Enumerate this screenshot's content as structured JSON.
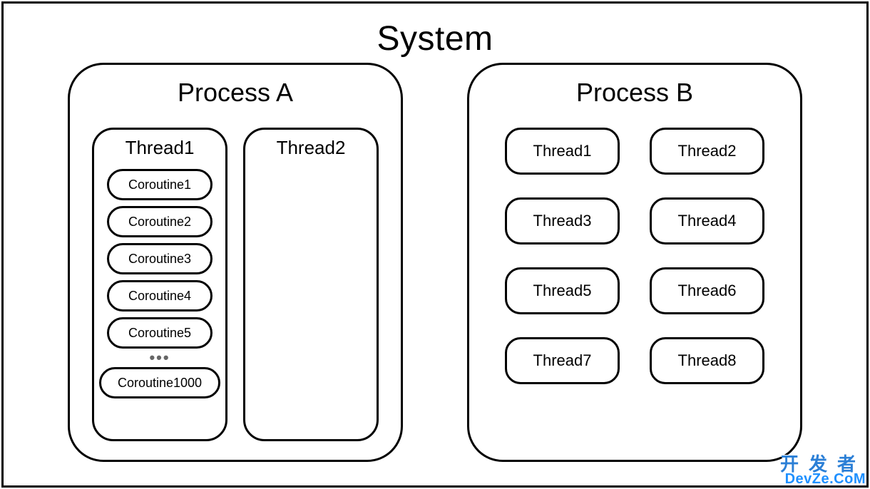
{
  "system": {
    "title": "System"
  },
  "processA": {
    "title": "Process A",
    "thread1": {
      "title": "Thread1",
      "coroutines": [
        "Coroutine1",
        "Coroutine2",
        "Coroutine3",
        "Coroutine4",
        "Coroutine5"
      ],
      "ellipsis": "•••",
      "last": "Coroutine1000"
    },
    "thread2": {
      "title": "Thread2"
    }
  },
  "processB": {
    "title": "Process B",
    "threads": [
      "Thread1",
      "Thread2",
      "Thread3",
      "Thread4",
      "Thread5",
      "Thread6",
      "Thread7",
      "Thread8"
    ]
  },
  "watermark": {
    "line1": "开发者",
    "line2": "DevZe.CoM"
  }
}
